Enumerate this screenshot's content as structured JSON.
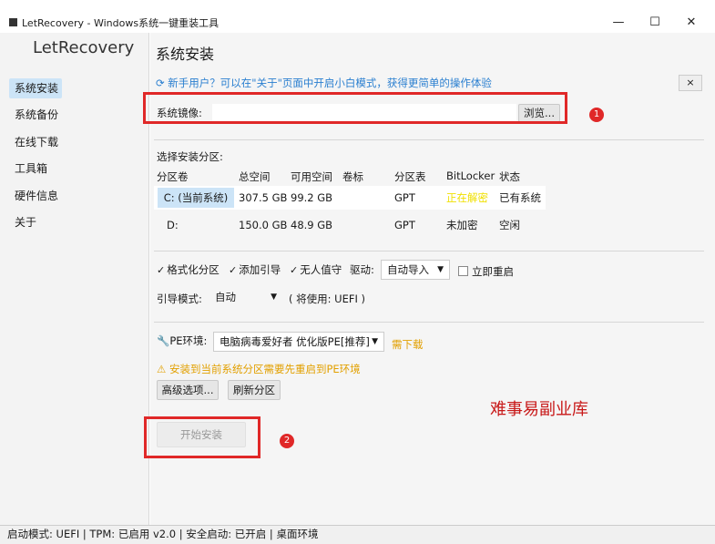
{
  "window": {
    "title": "LetRecovery - Windows系统一键重装工具",
    "minimize": "—",
    "maximize": "☐",
    "close": "✕"
  },
  "sidebar": {
    "brand": "LetRecovery",
    "items": [
      {
        "label": "系统安装",
        "active": true
      },
      {
        "label": "系统备份"
      },
      {
        "label": "在线下载"
      },
      {
        "label": "工具箱"
      },
      {
        "label": "硬件信息"
      },
      {
        "label": "关于"
      }
    ]
  },
  "main": {
    "title": "系统安装",
    "tip": "新手用户？可以在\"关于\"页面中开启小白模式，获得更简单的操作体验",
    "tip_close": "×",
    "image_label": "系统镜像:",
    "image_value": "",
    "browse": "浏览...",
    "partition_title": "选择安装分区:",
    "columns": [
      "分区卷",
      "总空间",
      "可用空间",
      "卷标",
      "分区表",
      "BitLocker",
      "状态"
    ],
    "partitions": [
      {
        "vol": "C: (当前系统)",
        "total": "307.5 GB",
        "free": "99.2 GB",
        "label": "",
        "table": "GPT",
        "bitlocker": "正在解密",
        "status": "已有系统"
      },
      {
        "vol": "D:",
        "total": "150.0 GB",
        "free": "48.9 GB",
        "label": "",
        "table": "GPT",
        "bitlocker": "未加密",
        "status": "空闲"
      }
    ],
    "opts": {
      "format": "格式化分区",
      "boot": "添加引导",
      "unattend": "无人值守",
      "driver_label": "驱动:",
      "driver_value": "自动导入",
      "restart": "立即重启"
    },
    "boot_mode_label": "引导模式:",
    "boot_mode_value": "自动",
    "boot_mode_hint": "( 将使用: UEFI )",
    "pe_label": "PE环境:",
    "pe_value": "电脑病毒爱好者 优化版PE[推荐]",
    "pe_download": "需下载",
    "warn": "安装到当前系统分区需要先重启到PE环境",
    "advanced": "高级选项...",
    "refresh": "刷新分区",
    "start": "开始安装"
  },
  "annotations": {
    "badge1": "1",
    "badge2": "2",
    "watermark": "难事易副业库"
  },
  "status": "启动模式: UEFI | TPM: 已启用 v2.0 | 安全启动: 已开启 | 桌面环境"
}
